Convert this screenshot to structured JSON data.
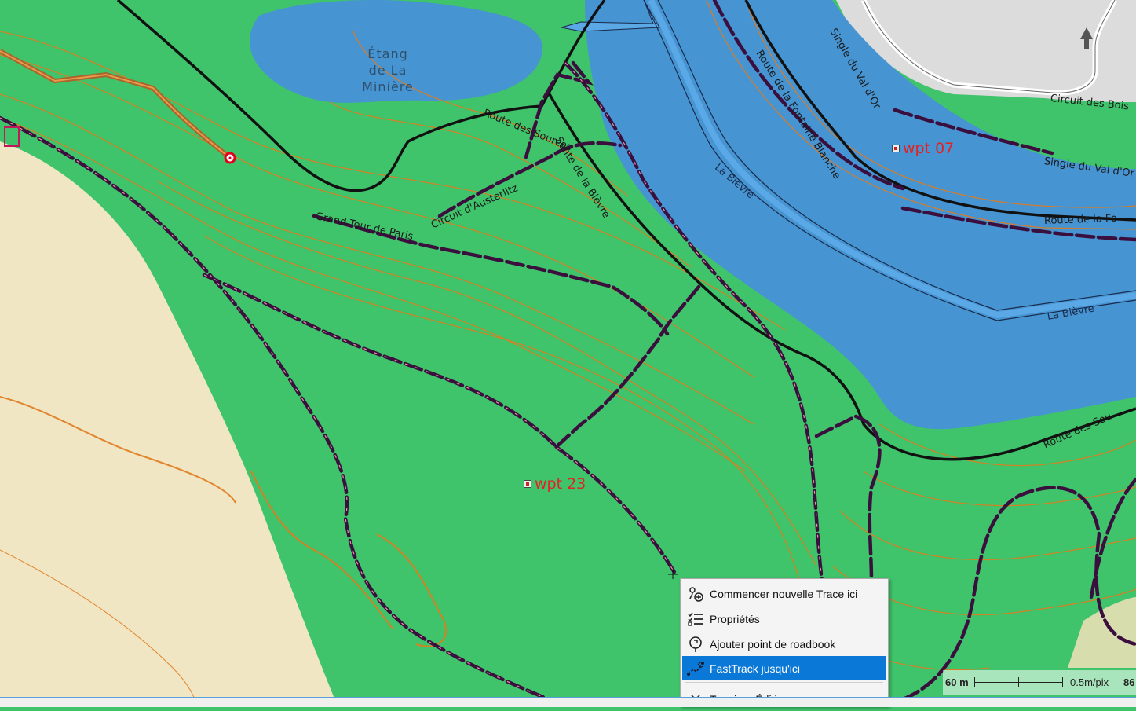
{
  "map": {
    "lake_label": "Étang\nde La\nMinière",
    "river_labels": [
      "La Bièvre",
      "La Bièvre"
    ],
    "road_labels": [
      "Route des Sources",
      "Circuit d'Austerlitz",
      "Route de la Fontaine Blanche",
      "Sente de la Bièvre",
      "Grand Tour de Paris",
      "Single du Val d'Or",
      "Route de la Fontaine Blanche",
      "Circuit des Bois",
      "Single du Val d'Or",
      "Route de la Fo",
      "Route des Sou"
    ],
    "waypoints": [
      {
        "label": "wpt 07"
      },
      {
        "label": "wpt 23"
      }
    ],
    "colors": {
      "forest": "#3fc46b",
      "water": "#4694d2",
      "sand": "#f1e6c3",
      "contour": "#e07b1e",
      "track": "#3a0f3d",
      "waypoint": "#e32222"
    }
  },
  "context_menu": {
    "items": [
      {
        "label": "Commencer nouvelle Trace ici",
        "icon": "start-track-icon"
      },
      {
        "label": "Propriétés",
        "icon": "properties-list-icon"
      },
      {
        "label": "Ajouter point de roadbook",
        "icon": "roadbook-pin-icon"
      },
      {
        "label": "FastTrack jusqu'ici",
        "icon": "fasttrack-icon"
      },
      {
        "label": "Terminer Édition",
        "icon": "close-icon"
      }
    ]
  },
  "scale": {
    "distance": "60 m",
    "resolution": "0.5m/pix",
    "zoom": "86"
  }
}
